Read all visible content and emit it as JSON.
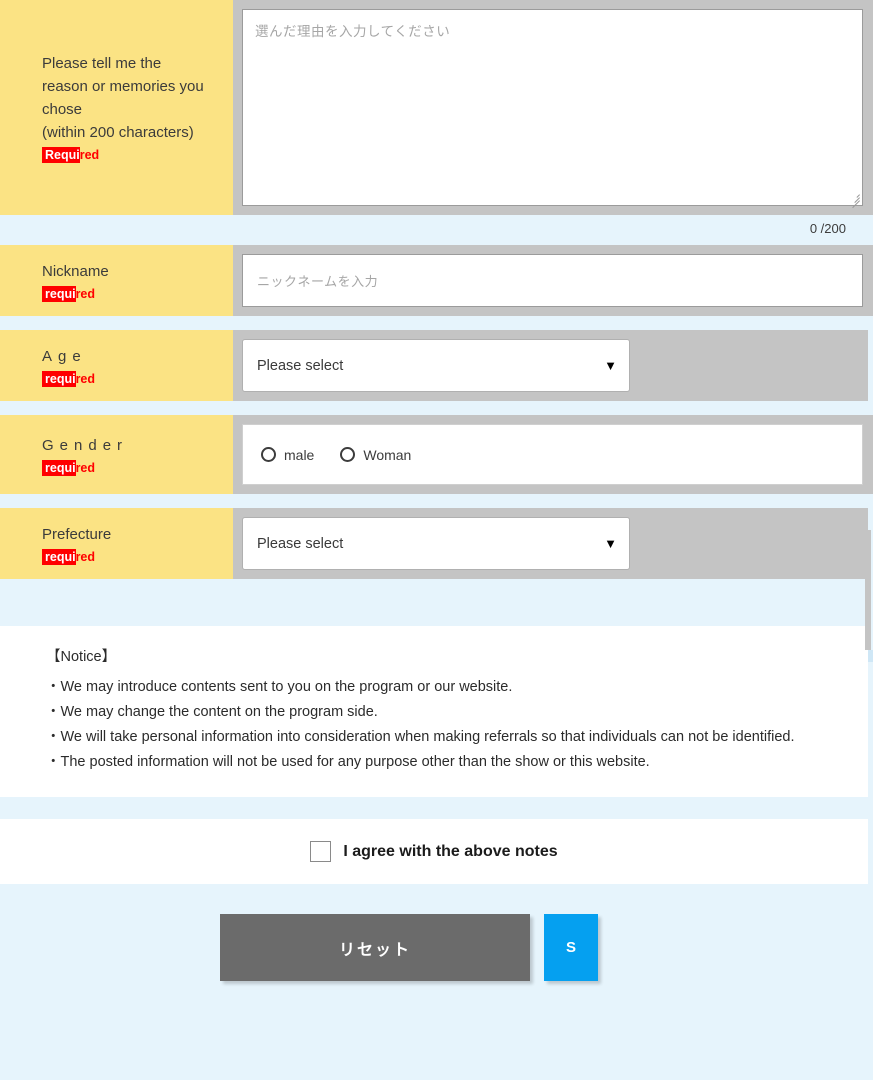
{
  "theme": {
    "page_bg": "#e6f4fc",
    "label_bg": "#fbe384",
    "field_bg": "#c4c4c4",
    "required_red": "#ff0000",
    "reset_gray": "#6b6b6b",
    "submit_blue": "#05a0f0"
  },
  "form": {
    "reason": {
      "label": "Please tell me the reason or memories you chose (within 200 characters)",
      "label_line1": "Please tell me the",
      "label_line2": "reason or memories you",
      "label_line3": "chose",
      "label_line4": "(within 200 characters)",
      "required_badge_head": "Requi",
      "required_badge_tail": "red",
      "placeholder": "選んだ理由を入力してください",
      "value": "",
      "counter": "0 /200",
      "count_current": 0,
      "count_max": 200
    },
    "nickname": {
      "label": "Nickname",
      "required_badge_head": "requi",
      "required_badge_tail": "red",
      "placeholder": "ニックネームを入力",
      "value": ""
    },
    "age": {
      "label": "Age",
      "required_badge_head": "requi",
      "required_badge_tail": "red",
      "selected": "Please select"
    },
    "gender": {
      "label": "Gender",
      "required_badge_head": "requi",
      "required_badge_tail": "red",
      "options": [
        {
          "label": "male",
          "checked": false
        },
        {
          "label": "Woman",
          "checked": false
        }
      ]
    },
    "prefecture": {
      "label": "Prefecture",
      "required_badge_head": "requi",
      "required_badge_tail": "red",
      "selected": "Please select"
    }
  },
  "notice": {
    "title": "【Notice】",
    "lines": [
      "・We may introduce contents sent to you on the program or our website.",
      "・We may change the content on the program side.",
      "・We will take personal information into consideration when making referrals so that individuals can not be identified.",
      "・The posted information will not be used for any purpose other than the show or this website."
    ]
  },
  "agreement": {
    "label": "I agree with the above notes",
    "checked": false
  },
  "buttons": {
    "reset": "リセット",
    "submit": "S"
  }
}
